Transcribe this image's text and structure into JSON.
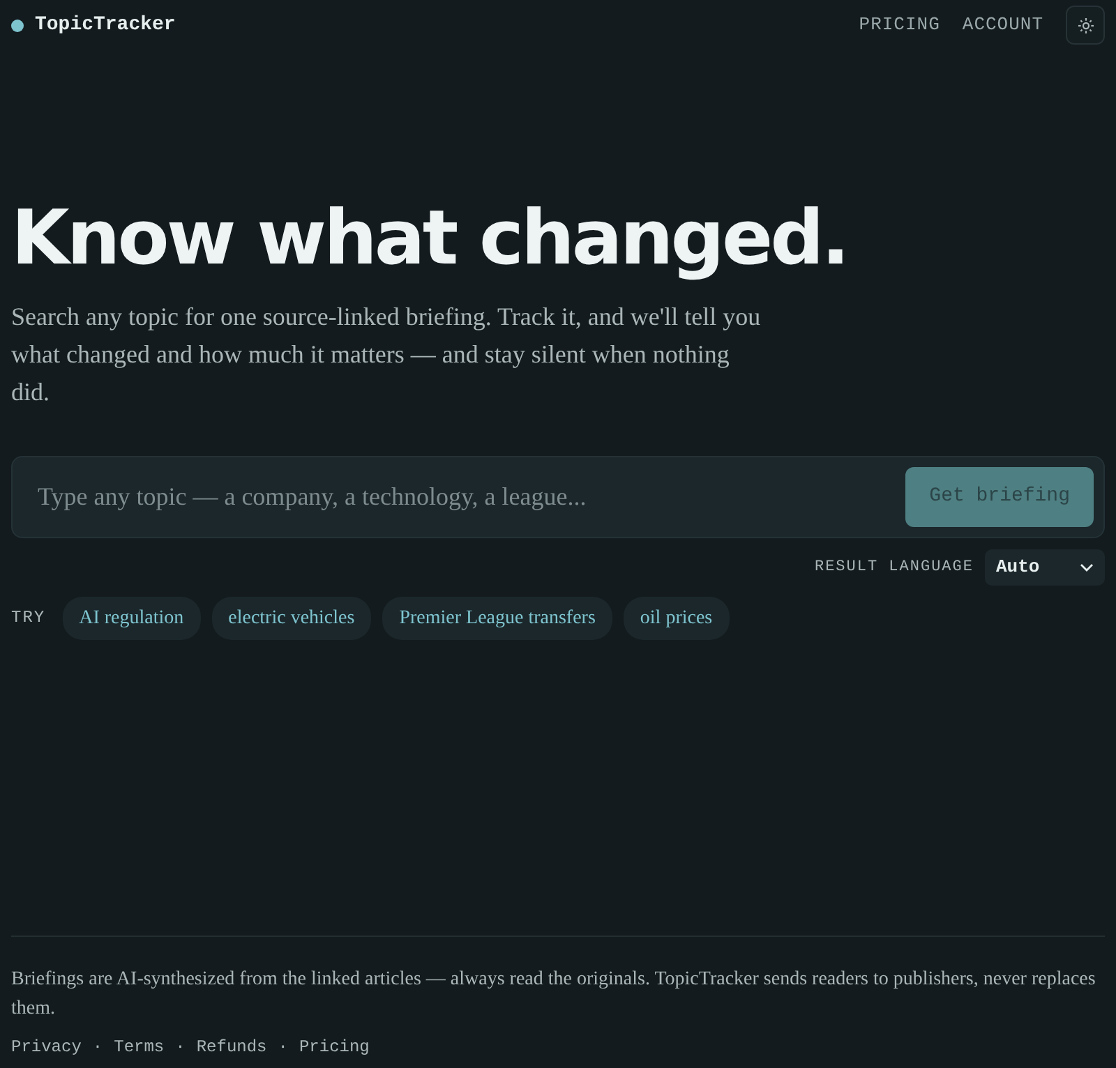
{
  "brand": {
    "name": "TopicTracker"
  },
  "nav": [
    {
      "label": "PRICING"
    },
    {
      "label": "ACCOUNT"
    }
  ],
  "hero": {
    "title": "Know what changed.",
    "subtitle": "Search any topic for one source-linked briefing. Track it, and we'll tell you what changed and how much it matters — and stay silent when nothing did."
  },
  "search": {
    "placeholder": "Type any topic — a company, a technology, a league...",
    "button": {
      "label": "Get briefing",
      "disabled": true
    }
  },
  "language": {
    "label": "RESULT LANGUAGE",
    "value": "Auto"
  },
  "suggestions": {
    "label": "TRY",
    "items": [
      {
        "label": "AI regulation"
      },
      {
        "label": "electric vehicles"
      },
      {
        "label": "Premier League transfers"
      },
      {
        "label": "oil prices"
      }
    ]
  },
  "footer": {
    "note": "Briefings are AI-synthesized from the linked articles — always read the originals. TopicTracker sends readers to publishers, never replaces them.",
    "links": [
      {
        "label": "Privacy"
      },
      {
        "label": "Terms",
        "separator": "·"
      },
      {
        "label": "Refunds",
        "separator": "·"
      },
      {
        "label": "Pricing",
        "separator": "·"
      }
    ]
  }
}
